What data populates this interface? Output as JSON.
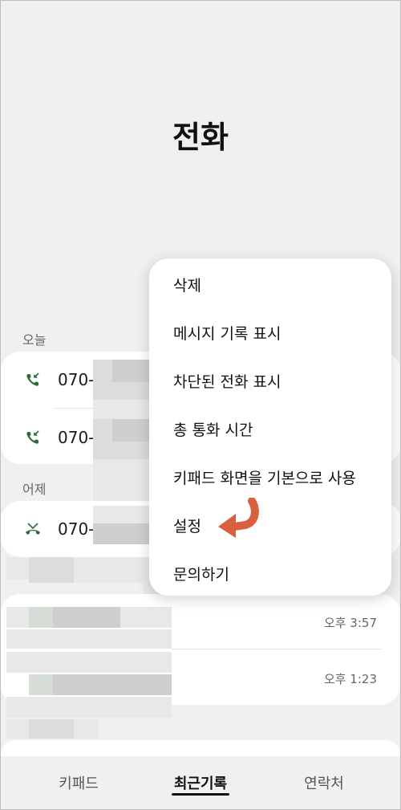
{
  "header": {
    "title": "전화"
  },
  "sections": {
    "today": "오늘",
    "yesterday": "어제"
  },
  "calls": [
    {
      "number": "070-",
      "type": "incoming",
      "icon": "incoming-call-icon"
    },
    {
      "number": "070-",
      "type": "incoming",
      "icon": "incoming-call-icon"
    },
    {
      "number": "070-",
      "type": "missed",
      "icon": "missed-call-icon"
    }
  ],
  "other_times": [
    "오후 3:57",
    "오후 1:23"
  ],
  "menu": {
    "items": [
      "삭제",
      "메시지 기록 표시",
      "차단된 전화 표시",
      "총 통화 시간",
      "키패드 화면을 기본으로 사용",
      "설정",
      "문의하기"
    ],
    "highlight": "설정"
  },
  "bottom_nav": {
    "tabs": [
      "키패드",
      "최근기록",
      "연락처"
    ],
    "active": "최근기록"
  },
  "colors": {
    "background": "#f0f0f0",
    "card": "#ffffff",
    "call_icon": "#2e6b3a",
    "annotation_arrow": "#d9603f"
  }
}
